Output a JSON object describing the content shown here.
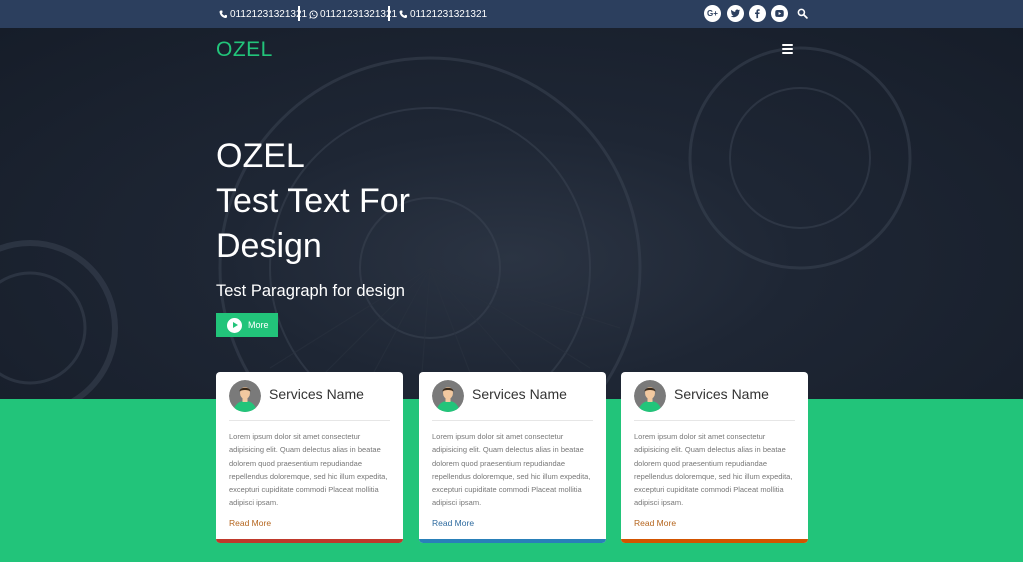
{
  "topbar": {
    "phone1": "01121231321321",
    "whatsapp": "01121231321321",
    "phone2": "01121231321321",
    "social_icons": [
      "google-plus-icon",
      "twitter-icon",
      "facebook-icon",
      "youtube-icon"
    ],
    "search_icon": "search-icon"
  },
  "nav": {
    "logo": "OZEL",
    "menu_icon": "hamburger-menu-icon"
  },
  "hero": {
    "line1": "OZEL",
    "line2": "Test Text For",
    "line3": "Design",
    "subtitle": "Test Paragraph for design",
    "button_label": "More",
    "button_icon": "play-circle-icon"
  },
  "colors": {
    "accent": "#22c47a",
    "topbar": "#2c3f5e",
    "hero_bg": "#1d2431",
    "card_bar_1": "#c0392b",
    "card_bar_2": "#2980b9",
    "card_bar_3": "#d35400"
  },
  "cards": [
    {
      "title": "Services Name",
      "body": "Lorem ipsum dolor sit amet consectetur adipisicing elit. Quam delectus alias in beatae dolorem quod praesentium repudiandae repellendus doloremque, sed hic illum expedita, excepturi cupiditate commodi Placeat mollitia adipisci ipsam.",
      "link": "Read More",
      "link_color": "#b5651d",
      "bar_color": "#c0392b"
    },
    {
      "title": "Services Name",
      "body": "Lorem ipsum dolor sit amet consectetur adipisicing elit. Quam delectus alias in beatae dolorem quod praesentium repudiandae repellendus doloremque, sed hic illum expedita, excepturi cupiditate commodi Placeat mollitia adipisci ipsam.",
      "link": "Read More",
      "link_color": "#2d6a9f",
      "bar_color": "#2980b9"
    },
    {
      "title": "Services Name",
      "body": "Lorem ipsum dolor sit amet consectetur adipisicing elit. Quam delectus alias in beatae dolorem quod praesentium repudiandae repellendus doloremque, sed hic illum expedita, excepturi cupiditate commodi Placeat mollitia adipisci ipsam.",
      "link": "Read More",
      "link_color": "#b5651d",
      "bar_color": "#d35400"
    }
  ]
}
